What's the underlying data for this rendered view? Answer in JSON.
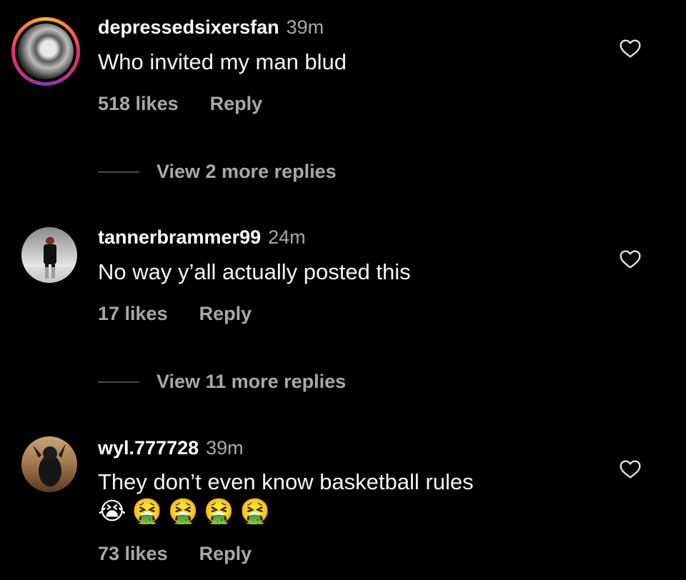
{
  "comments": [
    {
      "username": "depressedsixersfan",
      "time": "39m",
      "text": "Who invited my man blud",
      "likes": "518 likes",
      "reply_label": "Reply",
      "view_replies": "View 2 more replies",
      "story_ring": true
    },
    {
      "username": "tannerbrammer99",
      "time": "24m",
      "text": "No way y’all actually posted this",
      "likes": "17 likes",
      "reply_label": "Reply",
      "view_replies": "View 11 more replies",
      "story_ring": false
    },
    {
      "username": "wyl.777728",
      "time": "39m",
      "text": "They don’t even know basketball rules",
      "emojis": "😭🤮🤮🤮🤮",
      "likes": "73 likes",
      "reply_label": "Reply",
      "story_ring": false
    }
  ],
  "icons": {
    "like": "heart-outline-icon"
  },
  "colors": {
    "background": "#000000",
    "primary_text": "#f5f5f5",
    "secondary_text": "#a8a8a8",
    "story_ring": [
      "#f7b52c",
      "#e1306c",
      "#833ab4"
    ]
  }
}
